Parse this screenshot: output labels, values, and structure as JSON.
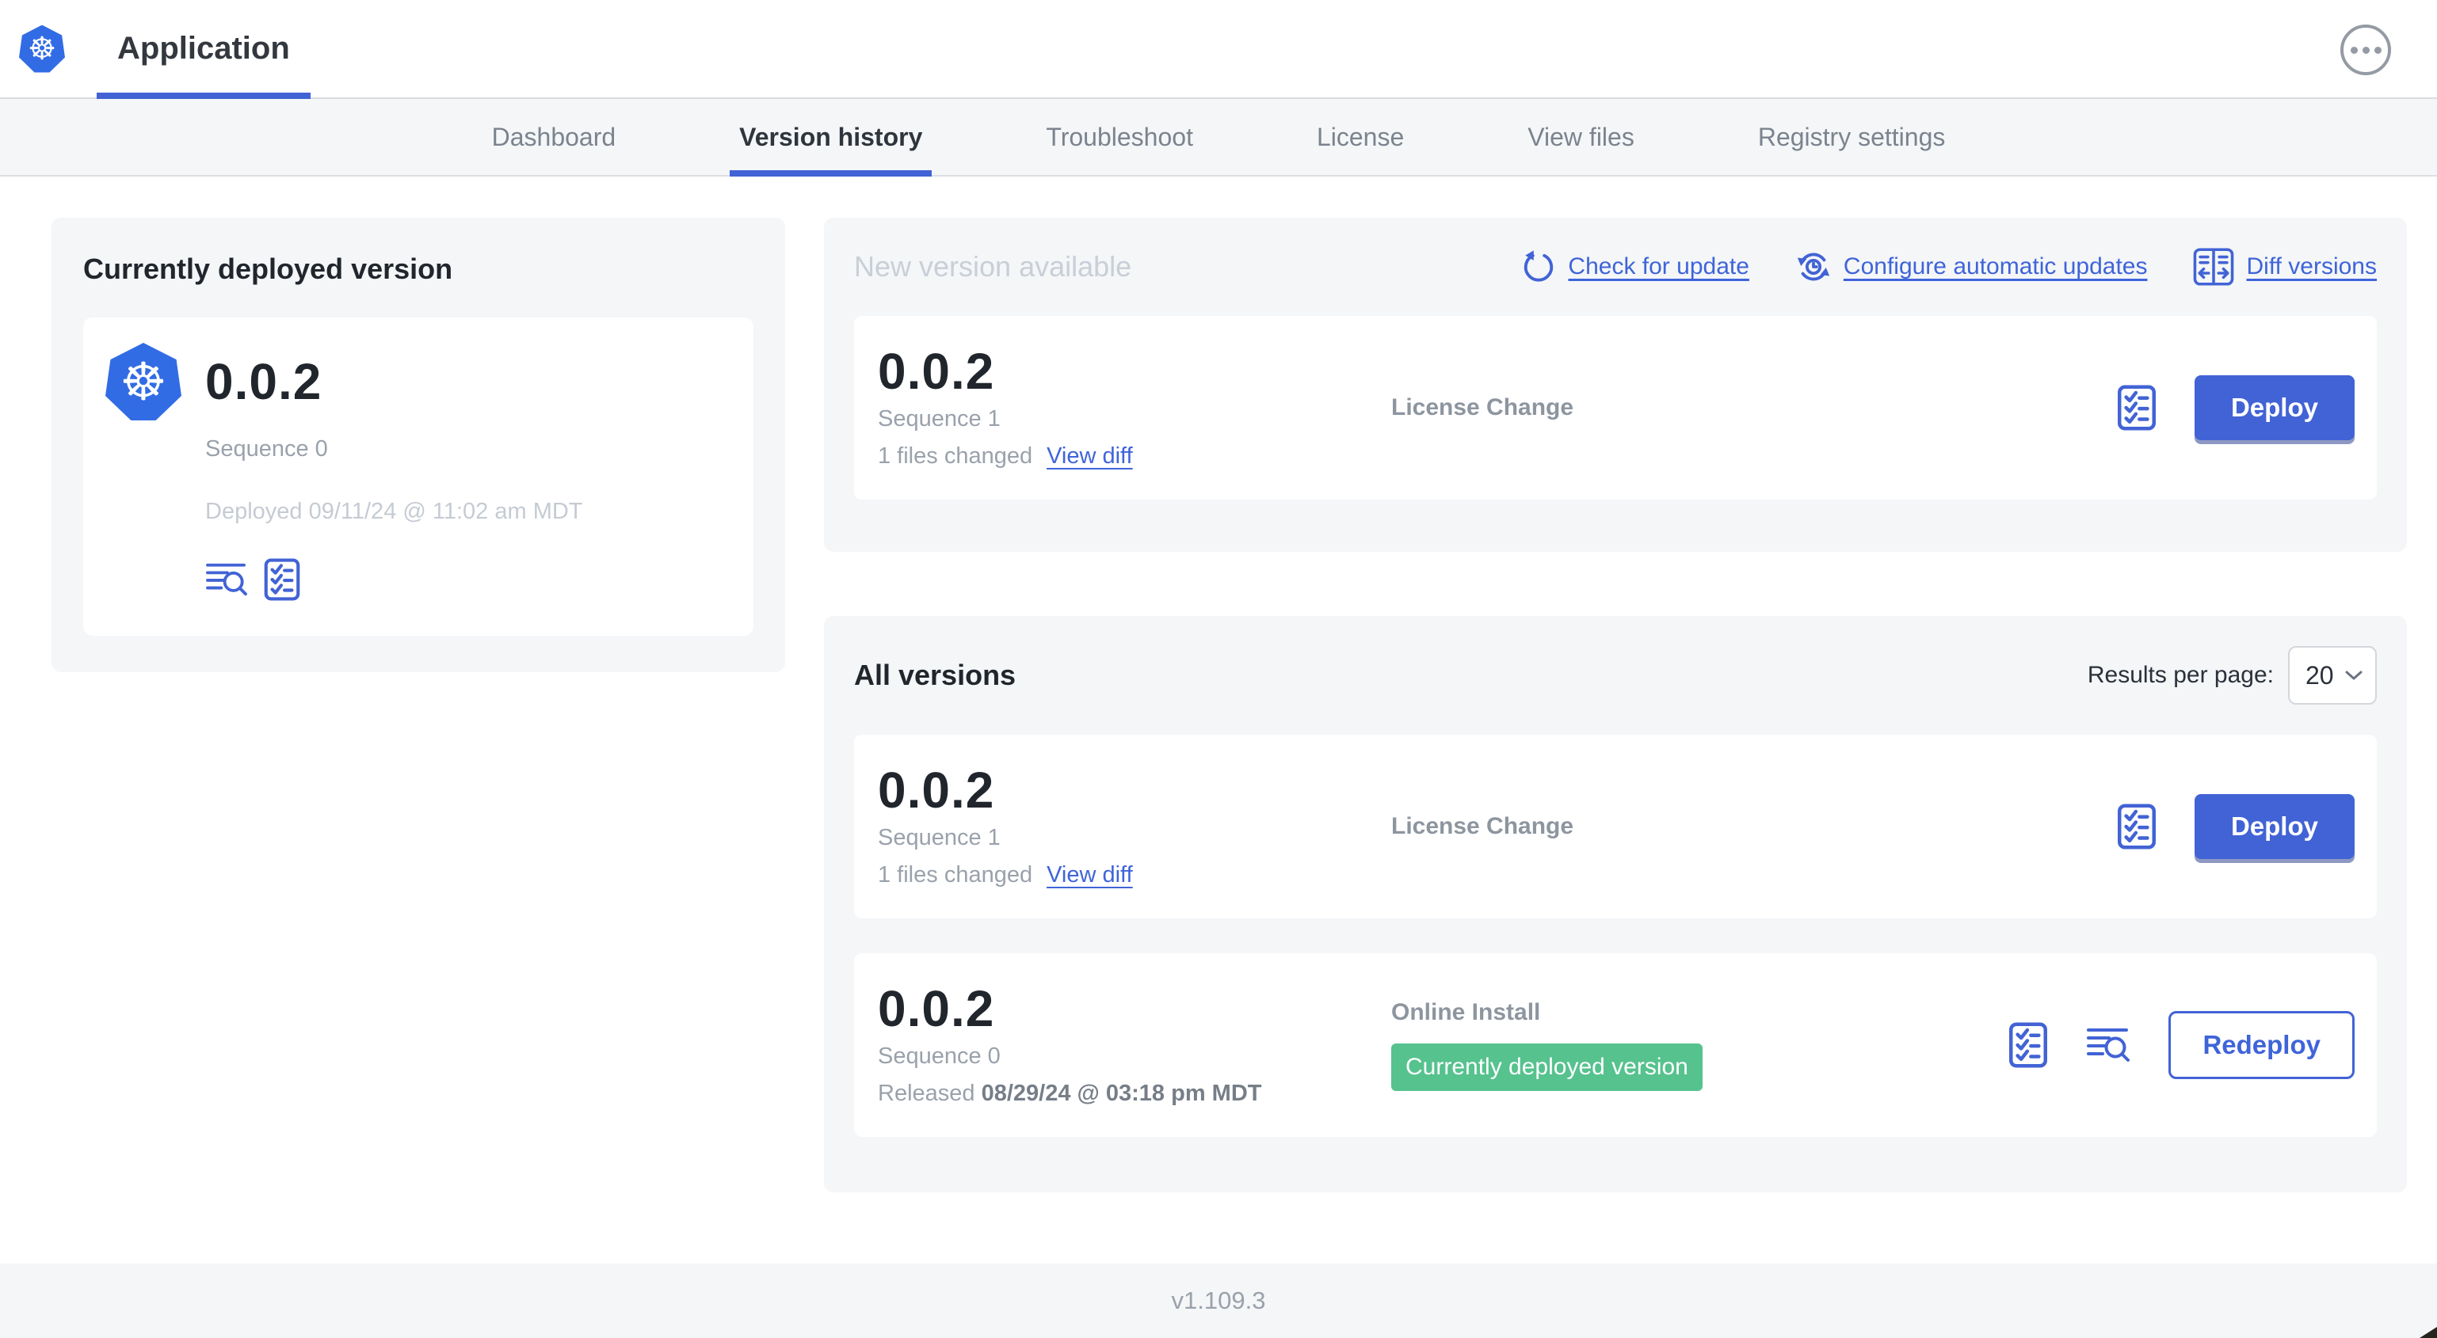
{
  "header": {
    "app_title": "Application",
    "menu_icon": "ellipsis-menu-icon",
    "logo_icon": "kubernetes-logo"
  },
  "nav": {
    "tabs": [
      {
        "label": "Dashboard",
        "active": false
      },
      {
        "label": "Version history",
        "active": true
      },
      {
        "label": "Troubleshoot",
        "active": false
      },
      {
        "label": "License",
        "active": false
      },
      {
        "label": "View files",
        "active": false
      },
      {
        "label": "Registry settings",
        "active": false
      }
    ]
  },
  "current_version": {
    "title": "Currently deployed version",
    "version": "0.0.2",
    "sequence": "Sequence 0",
    "deployed": "Deployed 09/11/24 @ 11:02 am MDT",
    "icons": [
      "logs-icon",
      "checklist-icon"
    ]
  },
  "new_version": {
    "title": "New version available",
    "actions": [
      {
        "label": "Check for update",
        "icon": "refresh-icon"
      },
      {
        "label": "Configure automatic updates",
        "icon": "auto-update-clock-icon"
      },
      {
        "label": "Diff versions",
        "icon": "diff-icon"
      }
    ],
    "row": {
      "version": "0.0.2",
      "sequence": "Sequence 1",
      "files_changed": "1 files changed",
      "view_diff_label": "View diff",
      "change_type": "License Change",
      "deploy_label": "Deploy",
      "icons": [
        "checklist-icon"
      ]
    }
  },
  "all_versions": {
    "title": "All versions",
    "results_per_page_label": "Results per page:",
    "results_per_page_value": "20",
    "rows": [
      {
        "version": "0.0.2",
        "sequence": "Sequence 1",
        "files_changed": "1 files changed",
        "view_diff_label": "View diff",
        "change_type": "License Change",
        "deploy_label": "Deploy",
        "icons": [
          "checklist-icon"
        ]
      },
      {
        "version": "0.0.2",
        "sequence": "Sequence 0",
        "released_prefix": "Released ",
        "released_date": "08/29/24 @ 03:18 pm MDT",
        "change_type": "Online Install",
        "badge_label": "Currently deployed version",
        "redeploy_label": "Redeploy",
        "icons": [
          "checklist-icon",
          "logs-icon"
        ]
      }
    ]
  },
  "footer": {
    "app_version": "v1.109.3"
  },
  "colors": {
    "accent_blue": "#4263d5",
    "link_blue": "#3f64d9",
    "kubernetes_blue": "#326ce5",
    "badge_green": "#56c28e",
    "panel_gray": "#f4f6f8"
  }
}
